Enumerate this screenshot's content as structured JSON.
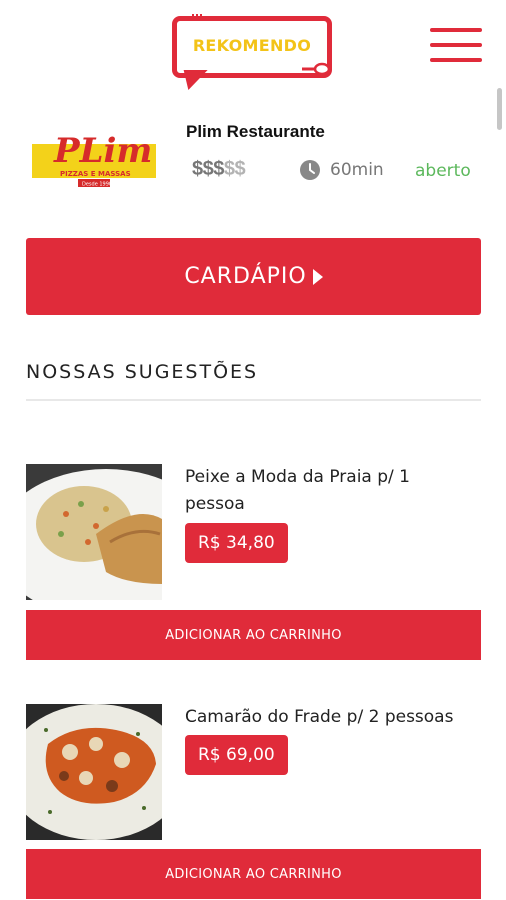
{
  "app": {
    "logo_text": "REKOMENDO",
    "menu_icon": "hamburger-icon"
  },
  "restaurant": {
    "name": "Plim Restaurante",
    "logo_text": "PLim",
    "logo_subtext": "PIZZAS E MASSAS",
    "logo_since": "Desde 1990",
    "price_level_active": "$$$",
    "price_level_inactive": "$$",
    "delivery_time": "60min",
    "status": "aberto"
  },
  "menu_button": {
    "label": "CARDÁPIO"
  },
  "suggestions": {
    "title": "NOSSAS SUGESTÕES",
    "items": [
      {
        "name": "Peixe a Moda da Praia p/ 1 pessoa",
        "price": "R$ 34,80",
        "add_label": "ADICIONAR AO CARRINHO"
      },
      {
        "name": "Camarão do Frade p/ 2 pessoas",
        "price": "R$ 69,00",
        "add_label": "ADICIONAR AO CARRINHO"
      }
    ]
  },
  "colors": {
    "accent": "#e02b3a",
    "logo_yellow": "#f3c318",
    "status_green": "#5cb85c"
  }
}
